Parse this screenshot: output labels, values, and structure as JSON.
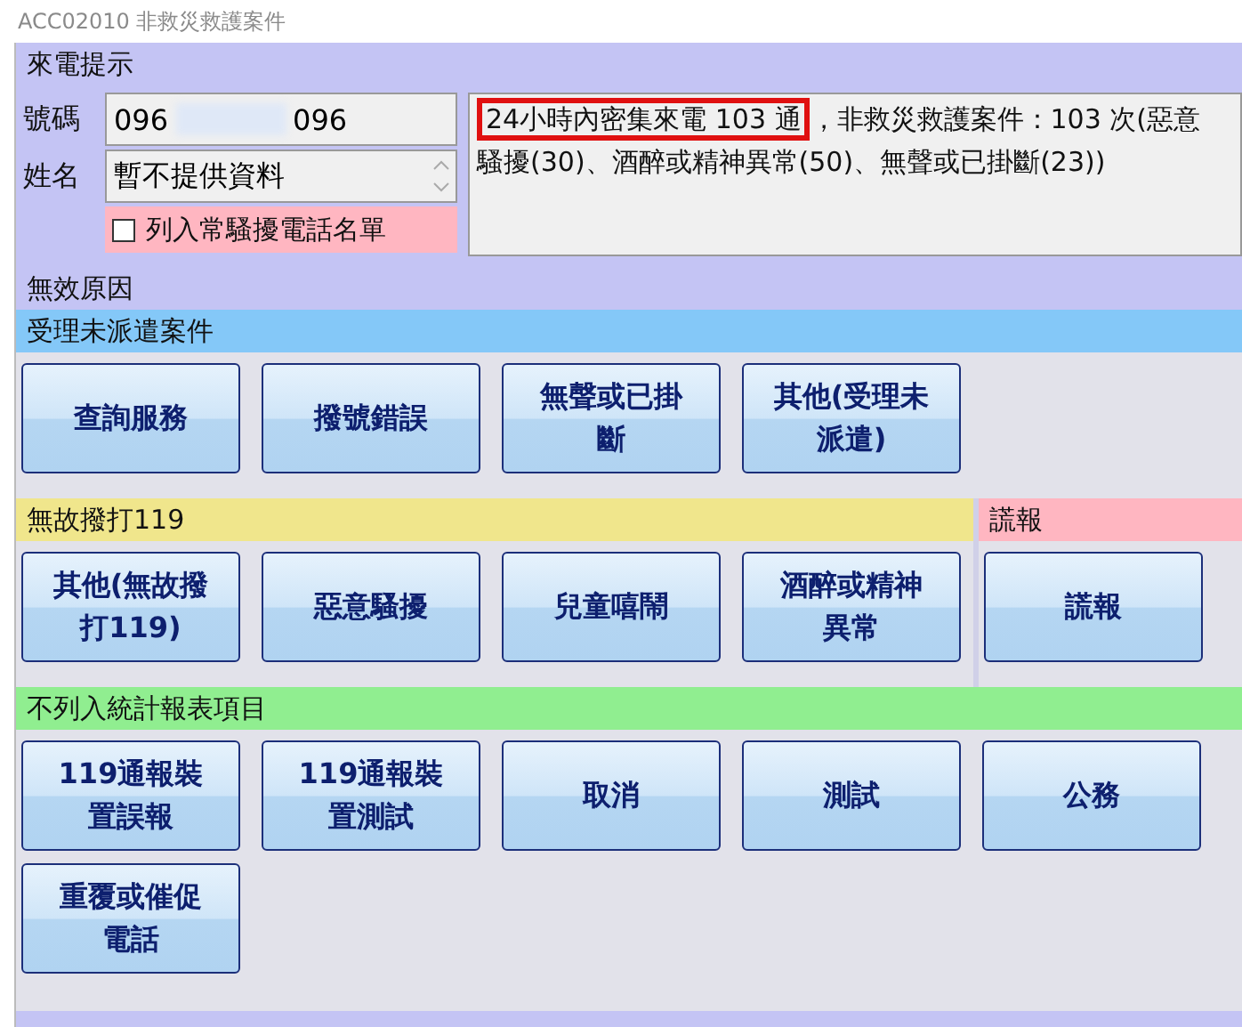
{
  "window": {
    "title": "ACC02010 非救災救護案件"
  },
  "caller": {
    "heading": "來電提示",
    "phone_label": "號碼",
    "phone_start": "096",
    "phone_end": "096",
    "name_label": "姓名",
    "name_value": "暫不提供資料",
    "blacklist": {
      "label": "列入常騷擾電話名單",
      "checked": false
    },
    "notice_highlight": "24小時內密集來電 103 通",
    "notice_rest": "，非救災救護案件：103 次(惡意騷擾(30)、酒醉或精神異常(50)、無聲或已掛斷(23))"
  },
  "invalid_heading": "無效原因",
  "sections": [
    {
      "title": "受理未派遣案件",
      "color": "#84c8f8",
      "buttons": [
        "查詢服務",
        "撥號錯誤",
        "無聲或已掛斷",
        "其他(受理未派遣)"
      ]
    },
    {
      "title": "無故撥打119",
      "color": "#f0e68c",
      "buttons": [
        "其他(無故撥打119)",
        "惡意騷擾",
        "兒童嘻鬧",
        "酒醉或精神異常"
      ],
      "side": {
        "title": "謊報",
        "color": "#ffb6c1",
        "buttons": [
          "謊報"
        ]
      }
    },
    {
      "title": "不列入統計報表項目",
      "color": "#90ee90",
      "buttons": [
        "119通報裝置誤報",
        "119通報裝置測試",
        "取消",
        "測試",
        "公務",
        "重覆或催促電話"
      ]
    }
  ]
}
